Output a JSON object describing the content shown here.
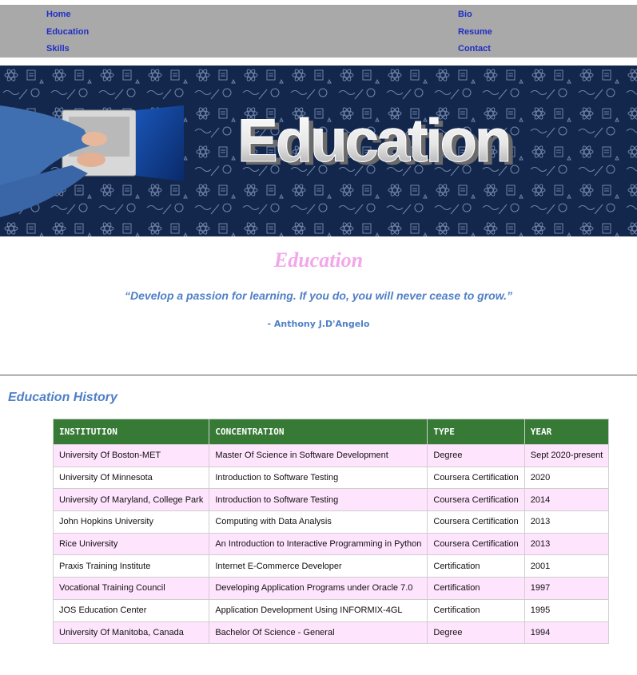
{
  "nav": {
    "home": "Home",
    "education": "Education",
    "skills": "Skills",
    "bio": "Bio",
    "resume": "Resume",
    "contact": "Contact"
  },
  "banner": {
    "text": "Education"
  },
  "page": {
    "title": "Education",
    "quote": "“Develop a passion for learning. If you do, you will never cease to grow.”",
    "author": "- Anthony J.D'Angelo"
  },
  "history": {
    "title": "Education History",
    "headers": [
      "INSTITUTION",
      "CONCENTRATION",
      "TYPE",
      "YEAR"
    ],
    "rows": [
      [
        "University Of Boston-MET",
        "Master Of Science in Software Development",
        "Degree",
        "Sept 2020-present"
      ],
      [
        "University Of Minnesota",
        "Introduction to Software Testing",
        "Coursera Certification",
        "2020"
      ],
      [
        "University Of Maryland, College Park",
        "Introduction to Software Testing",
        "Coursera Certification",
        "2014"
      ],
      [
        "John Hopkins University",
        "Computing with Data Analysis",
        "Coursera Certification",
        "2013"
      ],
      [
        "Rice University",
        "An Introduction to Interactive Programming in Python",
        "Coursera Certification",
        "2013"
      ],
      [
        "Praxis Training Institute",
        "Internet E-Commerce Developer",
        "Certification",
        "2001"
      ],
      [
        "Vocational Training Council",
        "Developing Application Programs under Oracle 7.0",
        "Certification",
        "1997"
      ],
      [
        "JOS Education Center",
        "Application Development Using INFORMIX-4GL",
        "Certification",
        "1995"
      ],
      [
        "University Of Manitoba, Canada",
        "Bachelor Of Science - General",
        "Degree",
        "1994"
      ]
    ]
  },
  "colors": {
    "nav_bg": "#a9a9a9",
    "nav_link": "#1f2fc4",
    "title_pink": "#f2a7ea",
    "accent_blue": "#4f7fc6",
    "table_header": "#367a36",
    "row_pink": "#fee4fd"
  }
}
